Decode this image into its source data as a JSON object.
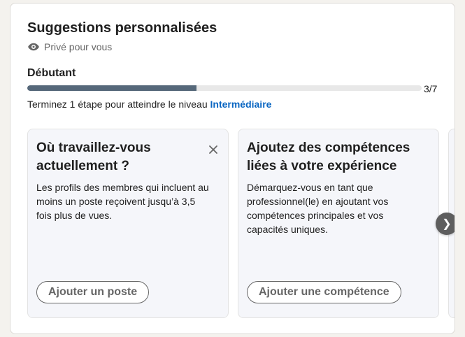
{
  "card": {
    "title": "Suggestions personnalisées",
    "privacy_label": "Privé pour vous",
    "privacy_icon": "eye-icon"
  },
  "progress": {
    "level": "Débutant",
    "current": 3,
    "total": 7,
    "count_label": "3/7",
    "fraction": 0.4286,
    "hint_prefix": "Terminez 1 étape pour atteindre le niveau ",
    "next_level": "Intermédiaire"
  },
  "suggestions": [
    {
      "title": "Où travaillez-vous actuellement ?",
      "description": "Les profils des membres qui incluent au moins un poste reçoivent jusqu’à 3,5 fois plus de vues.",
      "button": "Ajouter un poste",
      "dismiss_icon": "close-icon"
    },
    {
      "title": "Ajoutez des compétences liées à votre expérience",
      "description": "Démarquez-vous en tant que professionnel(le) en ajoutant vos compétences principales et vos capacités uniques.",
      "button": "Ajouter une compétence"
    }
  ],
  "carousel": {
    "next_icon": "chevron-right-icon",
    "next_glyph": "❯"
  },
  "colors": {
    "progress_fill": "#56687a",
    "link": "#0a66c2",
    "card_bg": "#f5f6fa"
  }
}
